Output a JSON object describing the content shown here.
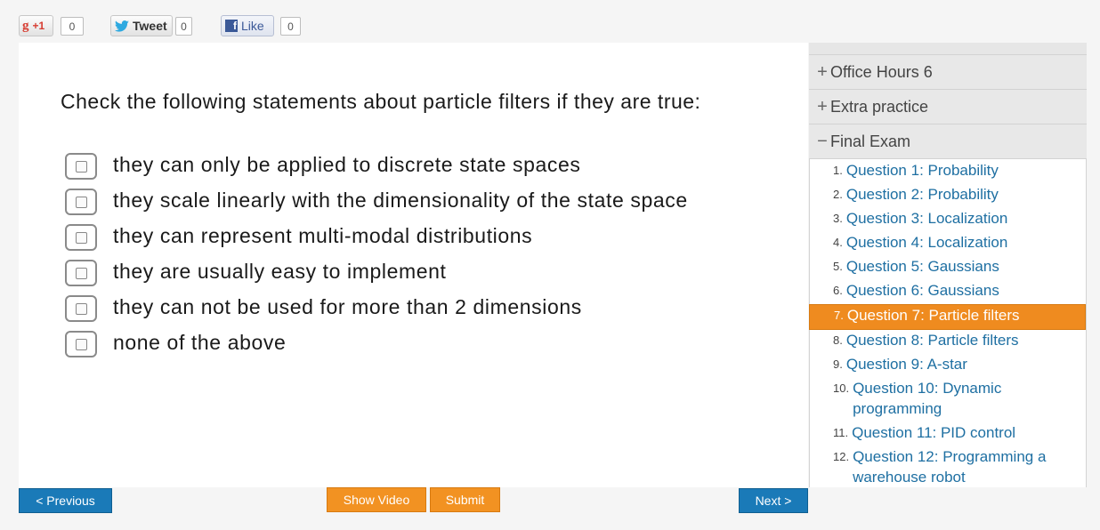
{
  "social": {
    "gplus": {
      "icon": "google-plus-icon",
      "label": "+1",
      "count": "0"
    },
    "twitter": {
      "icon": "twitter-bird-icon",
      "label": "Tweet",
      "count": "0"
    },
    "facebook": {
      "icon": "facebook-f-icon",
      "label": "Like",
      "count": "0"
    }
  },
  "quiz": {
    "question": "Check the following statements about particle filters if they are true:",
    "options": [
      {
        "label": "they can only be applied to discrete state spaces",
        "checked": false
      },
      {
        "label": "they scale linearly with the dimensionality of the state space",
        "checked": false
      },
      {
        "label": "they can represent multi-modal distributions",
        "checked": false
      },
      {
        "label": "they are usually easy to implement",
        "checked": false
      },
      {
        "label": "they can not be used for more than 2 dimensions",
        "checked": false
      },
      {
        "label": "none of the above",
        "checked": false
      }
    ]
  },
  "buttons": {
    "previous": "< Previous",
    "show_video": "Show Video",
    "submit": "Submit",
    "next": "Next >"
  },
  "sidebar": {
    "sections": [
      {
        "symbol": "+",
        "label": "Office Hours 6"
      },
      {
        "symbol": "+",
        "label": "Extra practice"
      },
      {
        "symbol": "−",
        "label": "Final Exam"
      }
    ],
    "questions": [
      {
        "num": "1.",
        "label": "Question 1: Probability"
      },
      {
        "num": "2.",
        "label": "Question 2: Probability"
      },
      {
        "num": "3.",
        "label": "Question 3: Localization"
      },
      {
        "num": "4.",
        "label": "Question 4: Localization"
      },
      {
        "num": "5.",
        "label": "Question 5: Gaussians"
      },
      {
        "num": "6.",
        "label": "Question 6: Gaussians"
      },
      {
        "num": "7.",
        "label": "Question 7: Particle filters",
        "active": true
      },
      {
        "num": "8.",
        "label": "Question 8: Particle filters"
      },
      {
        "num": "9.",
        "label": "Question 9: A-star"
      },
      {
        "num": "10.",
        "label": "Question 10: Dynamic programming"
      },
      {
        "num": "11.",
        "label": "Question 11: PID control"
      },
      {
        "num": "12.",
        "label": "Question 12: Programming a warehouse robot"
      }
    ]
  },
  "colors": {
    "accent_orange": "#f29222",
    "button_blue": "#1a7ab8",
    "link_blue": "#1e6fa2"
  }
}
